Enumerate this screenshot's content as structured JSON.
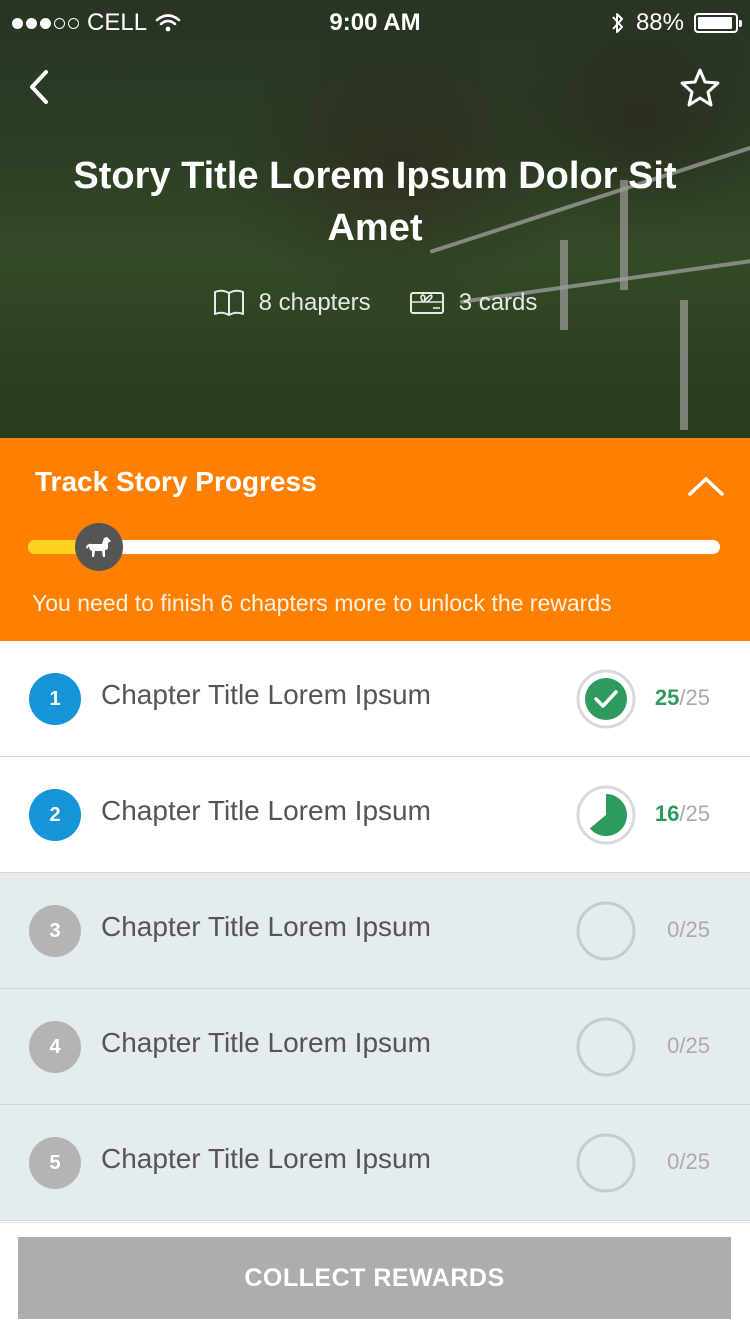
{
  "status_bar": {
    "carrier": "CELL",
    "time": "9:00 AM",
    "battery": "88%",
    "signal_strength": 3
  },
  "header": {
    "back_icon": "chevron-left-icon",
    "favorite_icon": "star-outline-icon",
    "story_title": "Story Title Lorem Ipsum Dolor Sit Amet",
    "chapters_label": "8 chapters",
    "cards_label": "3 cards"
  },
  "progress": {
    "title": "Track Story Progress",
    "collapse_icon": "chevron-up-icon",
    "knob_icon": "horse-icon",
    "fill_fraction": 0.1,
    "message": "You need to finish 6 chapters more to unlock the rewards",
    "colors": {
      "panel": "#ff7f00",
      "fill": "#ffd21f",
      "track": "#ffffff"
    }
  },
  "chapters": [
    {
      "number": "1",
      "title": "Chapter Title Lorem Ipsum",
      "done": "25",
      "total": "/25",
      "status": "complete",
      "fraction": 1.0
    },
    {
      "number": "2",
      "title": "Chapter Title Lorem Ipsum",
      "done": "16",
      "total": "/25",
      "status": "in-progress",
      "fraction": 0.64
    },
    {
      "number": "3",
      "title": "Chapter Title Lorem Ipsum",
      "done": "0",
      "total": "/25",
      "status": "locked",
      "fraction": 0
    },
    {
      "number": "4",
      "title": "Chapter Title Lorem Ipsum",
      "done": "0",
      "total": "/25",
      "status": "locked",
      "fraction": 0
    },
    {
      "number": "5",
      "title": "Chapter Title Lorem Ipsum",
      "done": "0",
      "total": "/25",
      "status": "locked",
      "fraction": 0
    }
  ],
  "footer": {
    "collect_label": "COLLECT REWARDS"
  },
  "colors": {
    "accent_blue": "#1595d8",
    "success_green": "#2f9a5e",
    "locked_gray": "#b4b4b4"
  }
}
